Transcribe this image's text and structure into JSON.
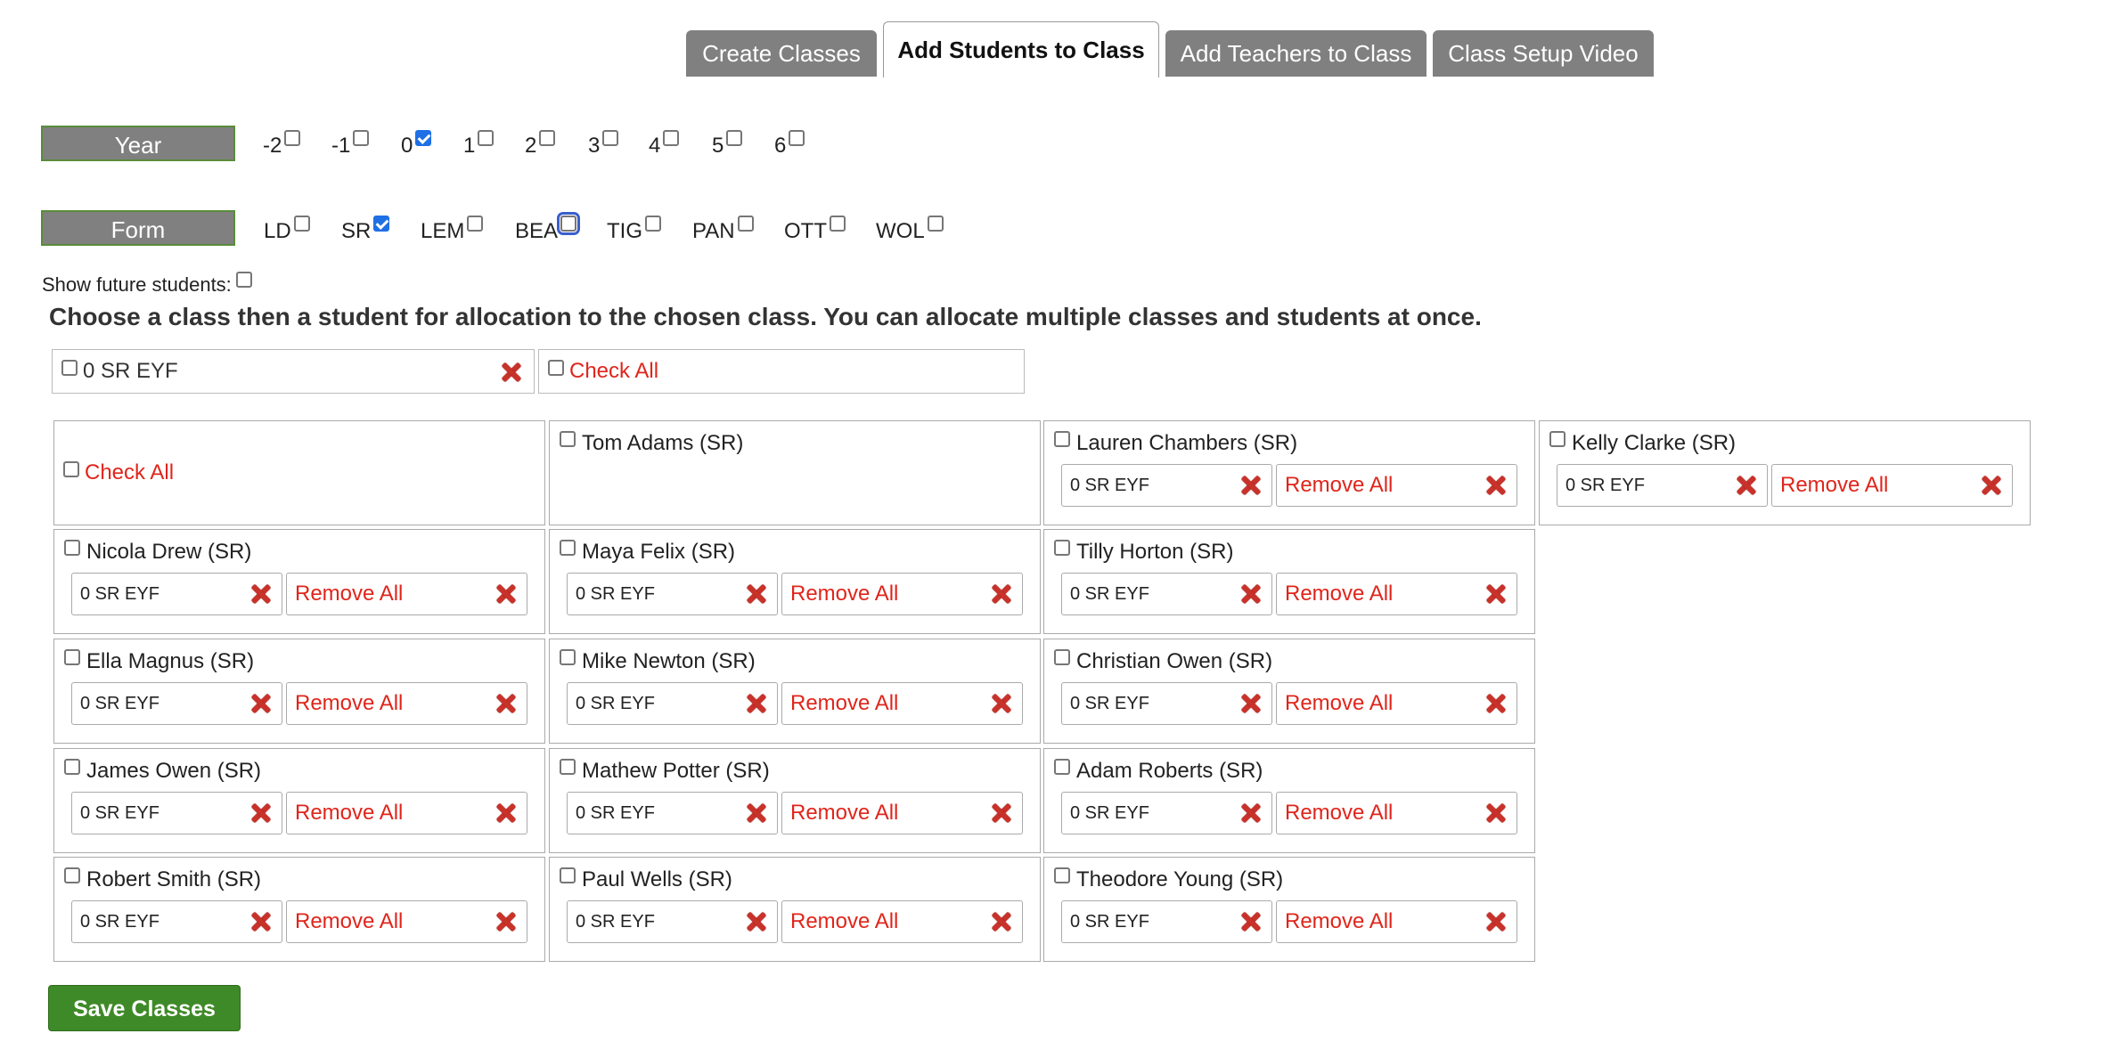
{
  "tabs": [
    {
      "label": "Create Classes",
      "active": false
    },
    {
      "label": "Add Students to Class",
      "active": true
    },
    {
      "label": "Add Teachers to Class",
      "active": false
    },
    {
      "label": "Class Setup Video",
      "active": false
    }
  ],
  "year": {
    "label": "Year",
    "options": [
      {
        "label": "-2",
        "checked": false
      },
      {
        "label": "-1",
        "checked": false
      },
      {
        "label": "0",
        "checked": true
      },
      {
        "label": "1",
        "checked": false
      },
      {
        "label": "2",
        "checked": false
      },
      {
        "label": "3",
        "checked": false
      },
      {
        "label": "4",
        "checked": false
      },
      {
        "label": "5",
        "checked": false
      },
      {
        "label": "6",
        "checked": false
      }
    ]
  },
  "form": {
    "label": "Form",
    "options": [
      {
        "label": "LD",
        "checked": false
      },
      {
        "label": "SR",
        "checked": true
      },
      {
        "label": "LEM",
        "checked": false
      },
      {
        "label": "BEA",
        "checked": false
      },
      {
        "label": "TIG",
        "checked": false
      },
      {
        "label": "PAN",
        "checked": false
      },
      {
        "label": "OTT",
        "checked": false
      },
      {
        "label": "WOL",
        "checked": false
      }
    ]
  },
  "future_students_label": "Show future students:",
  "instructions": "Choose a class then a student for allocation to the chosen class. You can allocate multiple classes and students at once.",
  "chosen_class": "0 SR EYF",
  "check_all_label": "Check All",
  "remove_all_label": "Remove All",
  "students": [
    {
      "name": "Tom Adams (SR)",
      "classes": []
    },
    {
      "name": "Lauren Chambers (SR)",
      "classes": [
        "0 SR EYF"
      ]
    },
    {
      "name": "Kelly Clarke (SR)",
      "classes": [
        "0 SR EYF"
      ]
    },
    {
      "name": "Nicola Drew (SR)",
      "classes": [
        "0 SR EYF"
      ]
    },
    {
      "name": "Maya Felix (SR)",
      "classes": [
        "0 SR EYF"
      ]
    },
    {
      "name": "Tilly Horton (SR)",
      "classes": [
        "0 SR EYF"
      ]
    },
    {
      "name": "Ella Magnus (SR)",
      "classes": [
        "0 SR EYF"
      ]
    },
    {
      "name": "Mike Newton (SR)",
      "classes": [
        "0 SR EYF"
      ]
    },
    {
      "name": "Christian Owen (SR)",
      "classes": [
        "0 SR EYF"
      ]
    },
    {
      "name": "James Owen (SR)",
      "classes": [
        "0 SR EYF"
      ]
    },
    {
      "name": "Mathew Potter (SR)",
      "classes": [
        "0 SR EYF"
      ]
    },
    {
      "name": "Adam Roberts (SR)",
      "classes": [
        "0 SR EYF"
      ]
    },
    {
      "name": "Robert Smith (SR)",
      "classes": [
        "0 SR EYF"
      ]
    },
    {
      "name": "Paul Wells (SR)",
      "classes": [
        "0 SR EYF"
      ]
    },
    {
      "name": "Theodore Young (SR)",
      "classes": [
        "0 SR EYF"
      ]
    }
  ],
  "save_label": "Save Classes",
  "colors": {
    "accent_red": "#e0251b",
    "tab_gray": "#808080",
    "save_green": "#3f8a28",
    "checkbox_blue": "#1f6fe5"
  }
}
